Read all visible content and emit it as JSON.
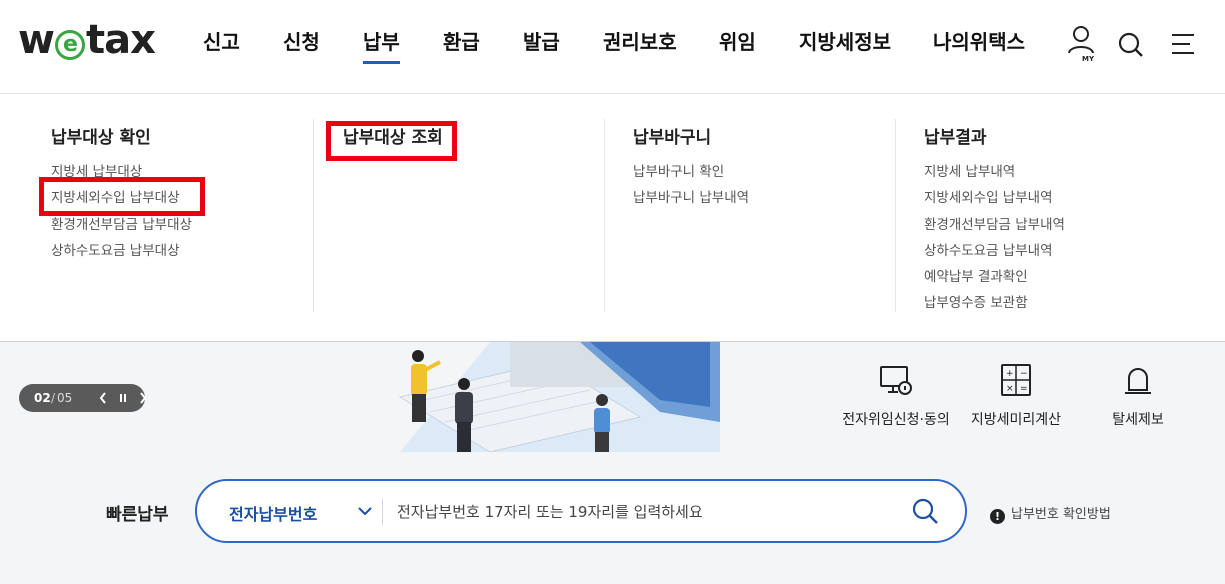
{
  "brand": {
    "logo_w": "w",
    "logo_e": "e",
    "logo_rest": "tax"
  },
  "nav": [
    {
      "label": "신고"
    },
    {
      "label": "신청"
    },
    {
      "label": "납부",
      "active": true
    },
    {
      "label": "환급"
    },
    {
      "label": "발급"
    },
    {
      "label": "권리보호"
    },
    {
      "label": "위임"
    },
    {
      "label": "지방세정보"
    },
    {
      "label": "나의위택스"
    }
  ],
  "util": {
    "my_label": "MY"
  },
  "mega": {
    "columns": [
      {
        "heading": "납부대상 확인",
        "items": [
          "지방세 납부대상",
          "지방세외수입 납부대상",
          "환경개선부담금 납부대상",
          "상하수도요금 납부대상"
        ]
      },
      {
        "heading": "납부대상 조회",
        "items": []
      },
      {
        "heading": "납부바구니",
        "items": [
          "납부바구니 확인",
          "납부바구니 납부내역"
        ]
      },
      {
        "heading": "납부결과",
        "items": [
          "지방세 납부내역",
          "지방세외수입 납부내역",
          "환경개선부담금 납부내역",
          "상하수도요금 납부내역",
          "예약납부 결과확인",
          "납부영수증 보관함"
        ]
      }
    ]
  },
  "banner": {
    "pager": {
      "current": "02",
      "separator": "/",
      "total": "05"
    },
    "quick_links": [
      {
        "label": "전자위임신청·동의",
        "icon": "monitor-lock-icon"
      },
      {
        "label": "지방세미리계산",
        "icon": "calculator-icon"
      },
      {
        "label": "탈세제보",
        "icon": "siren-icon"
      }
    ]
  },
  "quick_pay": {
    "title": "빠른납부",
    "select_value": "전자납부번호",
    "placeholder": "전자납부번호 17자리 또는 19자리를 입력하세요",
    "help_text": "납부번호 확인방법"
  },
  "colors": {
    "accent": "#1b5fc3",
    "highlight": "#ea0010",
    "logo_green": "#3aa540"
  }
}
